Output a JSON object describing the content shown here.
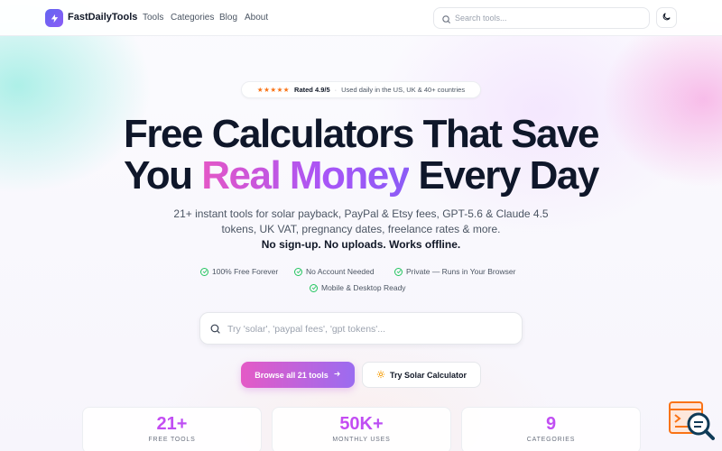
{
  "nav": {
    "brand": "FastDailyTools",
    "links": [
      "Tools",
      "Categories",
      "Blog",
      "About"
    ],
    "search_placeholder": "Search tools..."
  },
  "hero": {
    "rating_stars": "★★★★★",
    "rating_text": "Rated 4.9/5",
    "rating_separator": "·",
    "usage_text": "Used daily in the US, UK & 40+ countries",
    "title_line1": "Free Calculators That Save",
    "title_line2_pre": "You ",
    "title_accent": "Real Money",
    "title_line2_post": " Every Day",
    "subtitle_line1": "21+ instant tools for solar payback, PayPal & Etsy fees, GPT-5.6 & Claude 4.5",
    "subtitle_line2": "tokens, UK VAT, pregnancy dates, freelance rates & more.",
    "subtitle_strong": "No sign-up. No uploads. Works offline.",
    "features": [
      "100% Free Forever",
      "No Account Needed",
      "Private — Runs in Your Browser",
      "Mobile & Desktop Ready"
    ],
    "search_placeholder": "Try 'solar', 'paypal fees', 'gpt tokens'...",
    "primary_cta": "Browse all 21 tools",
    "secondary_cta": "Try Solar Calculator"
  },
  "stats": [
    {
      "value": "21+",
      "label": "FREE TOOLS"
    },
    {
      "value": "50K+",
      "label": "MONTHLY USES"
    },
    {
      "value": "9",
      "label": "CATEGORIES"
    }
  ],
  "colors": {
    "brand": "#6366f1",
    "accent_pink": "#e45ac6",
    "accent_purple": "#9b6cf0",
    "star": "#f97316",
    "check": "#22c55e"
  },
  "icons": [
    "lightning-icon",
    "search-icon",
    "moon-icon",
    "star-icon",
    "check-circle-icon",
    "arrow-right-icon",
    "sun-icon",
    "help-search-icon"
  ]
}
